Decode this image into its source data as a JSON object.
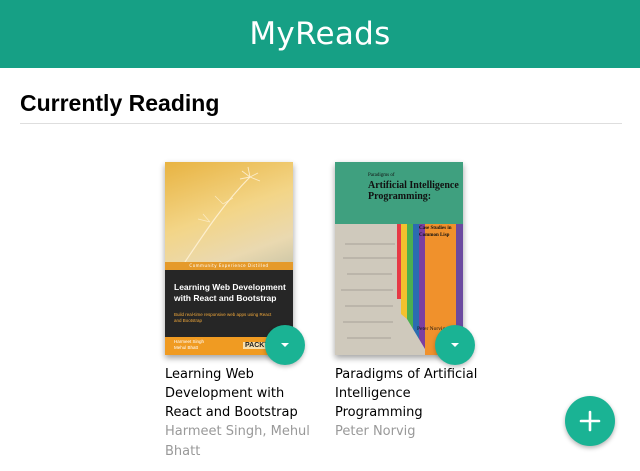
{
  "app": {
    "title": "MyReads"
  },
  "shelf": {
    "title": "Currently Reading",
    "books": [
      {
        "title": "Learning Web Development with React and Bootstrap",
        "authors": "Harmeet Singh, Mehul Bhatt",
        "cover": {
          "banner": "Community Experience Distilled",
          "title": "Learning Web Development with React and Bootstrap",
          "subtitle": "Build real-time responsive web apps using React and Bootstrap",
          "authors": "Harmeet Singh\nMehul Bhatt",
          "publisher": "PACKT"
        }
      },
      {
        "title": "Paradigms of Artificial Intelligence Programming",
        "authors": "Peter Norvig",
        "cover": {
          "title_small": "Paradigms of",
          "title_large": "Artificial Intelligence Programming:",
          "subtitle": "Case Studies in Common Lisp",
          "author": "Peter Norvig"
        }
      }
    ]
  },
  "colors": {
    "header": "#16a085",
    "fab": "#1ab394"
  },
  "icons": {
    "changer": "arrow-drop-down-icon",
    "add": "plus-icon"
  }
}
